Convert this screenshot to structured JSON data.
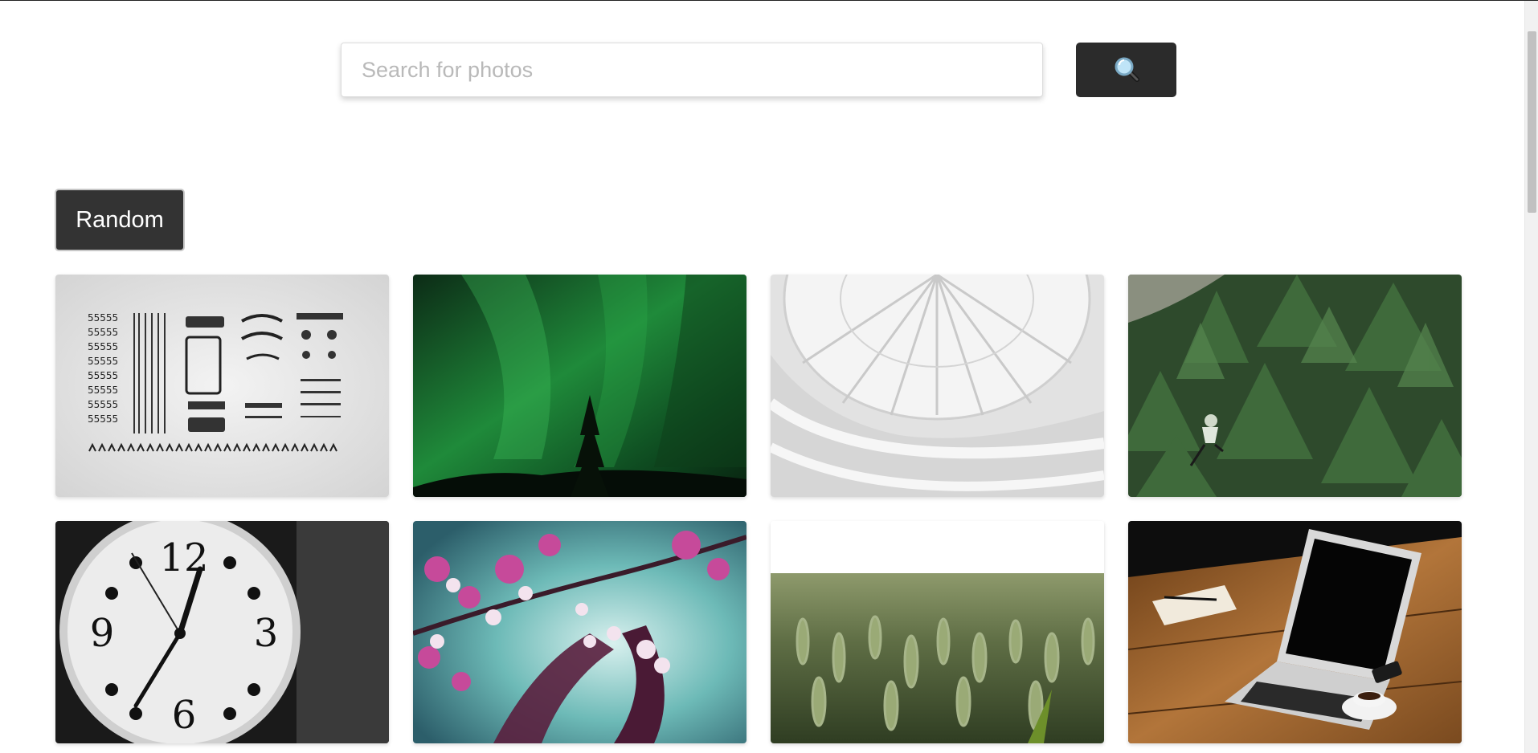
{
  "search": {
    "placeholder": "Search for photos",
    "button_icon": "magnifier-icon"
  },
  "random_button": {
    "label": "Random"
  },
  "photos": [
    {
      "subject": "typewriter-parts-knolling"
    },
    {
      "subject": "aurora-over-pine-tree"
    },
    {
      "subject": "white-spiral-atrium-skylight"
    },
    {
      "subject": "cyclist-in-green-forest"
    },
    {
      "subject": "black-and-white-clock"
    },
    {
      "subject": "pink-cherry-blossoms"
    },
    {
      "subject": "wheat-field"
    },
    {
      "subject": "laptop-and-coffee-on-desk"
    }
  ],
  "colors": {
    "button_bg": "#2b2b2b",
    "random_bg": "#333333",
    "placeholder": "#b9b9b9"
  }
}
